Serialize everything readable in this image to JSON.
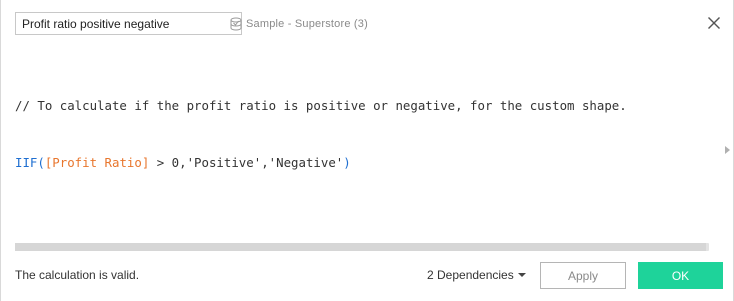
{
  "calculation": {
    "name_value": "Profit ratio positive negative",
    "datasource_label": "Sample - Superstore (3)"
  },
  "editor": {
    "comment": "// To calculate if the profit ratio is positive or negative, for the custom shape.",
    "func": "IIF(",
    "field": "[Profit Ratio]",
    "op": " > 0,",
    "str1": "'Positive'",
    "comma": ",",
    "str2": "'Negative'",
    "close": ")"
  },
  "footer": {
    "status": "The calculation is valid.",
    "dependencies": "2 Dependencies",
    "apply_label": "Apply",
    "ok_label": "OK"
  },
  "colors": {
    "ok_button": "#1ed39a",
    "function": "#1f6fd1",
    "field": "#e8762d"
  },
  "icons": {
    "datasource": "database-icon",
    "close": "close-icon",
    "dropdown": "caret-down-icon",
    "expand": "expand-panel-arrow-icon"
  }
}
